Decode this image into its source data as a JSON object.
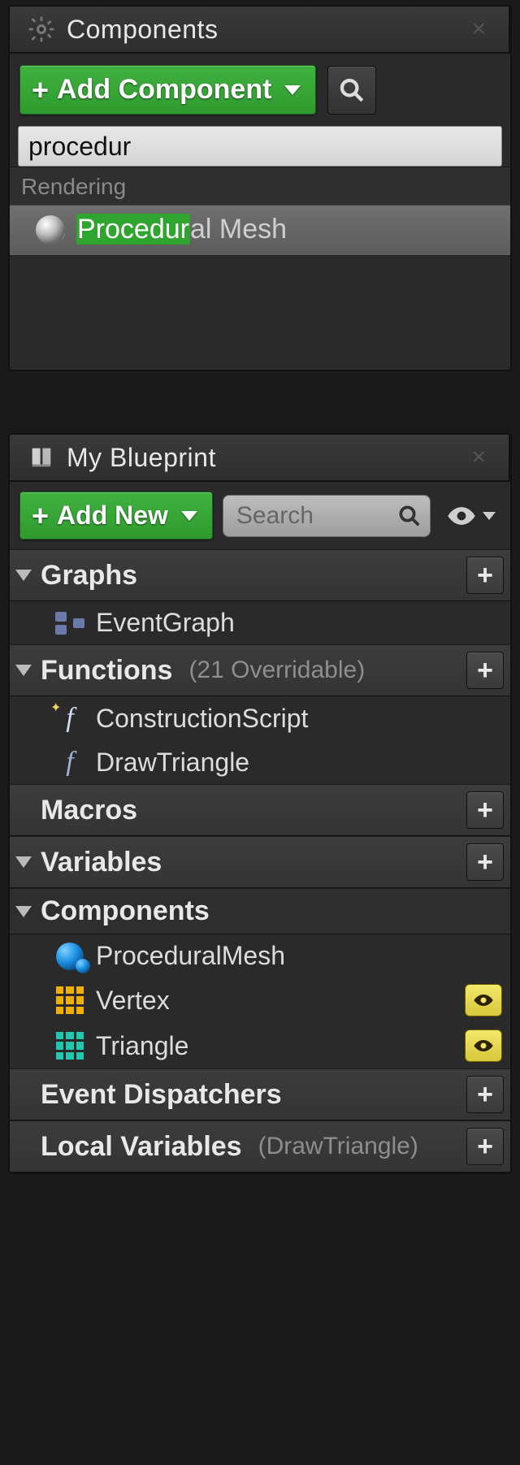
{
  "components_panel": {
    "title": "Components",
    "add_button": "Add Component",
    "search_value": "procedur",
    "category": "Rendering",
    "result_highlight": "Procedur",
    "result_rest": "al Mesh"
  },
  "blueprint_panel": {
    "title": "My Blueprint",
    "add_button": "Add New",
    "search_placeholder": "Search",
    "sections": {
      "graphs": {
        "label": "Graphs",
        "items": [
          {
            "label": "EventGraph",
            "icon": "nodes"
          }
        ]
      },
      "functions": {
        "label": "Functions",
        "sub": "(21 Overridable)",
        "items": [
          {
            "label": "ConstructionScript",
            "icon": "fn-star"
          },
          {
            "label": "DrawTriangle",
            "icon": "fn"
          }
        ]
      },
      "macros": {
        "label": "Macros"
      },
      "variables": {
        "label": "Variables"
      },
      "components": {
        "label": "Components",
        "items": [
          {
            "label": "ProceduralMesh",
            "icon": "sphere-blue",
            "eye": false
          },
          {
            "label": "Vertex",
            "icon": "grid-orange",
            "eye": true
          },
          {
            "label": "Triangle",
            "icon": "grid-teal",
            "eye": true
          }
        ]
      },
      "event_dispatchers": {
        "label": "Event Dispatchers"
      },
      "local_variables": {
        "label": "Local Variables",
        "sub": "(DrawTriangle)"
      }
    }
  }
}
